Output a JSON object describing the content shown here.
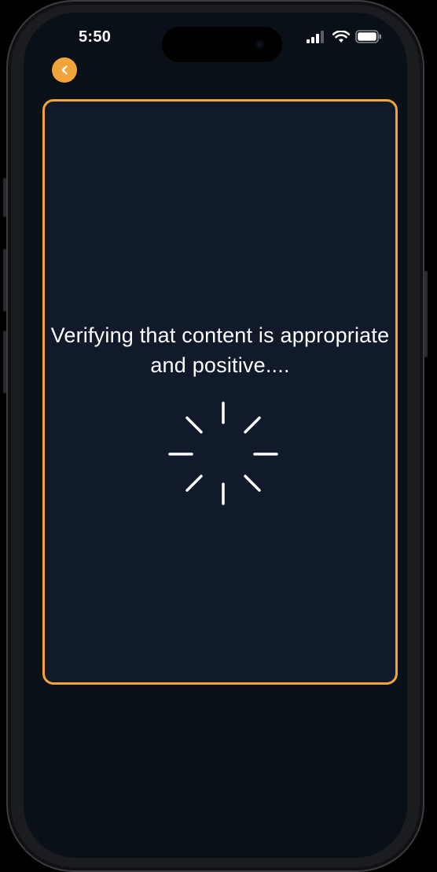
{
  "status_bar": {
    "time": "5:50",
    "icons": [
      "signal-icon",
      "wifi-icon",
      "battery-icon"
    ]
  },
  "header": {
    "back_label": "<"
  },
  "card": {
    "message": "Verifying that content is appropriate and positive....",
    "spinner_icon": "loading-spinner-icon"
  },
  "colors": {
    "accent": "#f2a33a",
    "card_background": "#111a2b",
    "screen_background": "#0a1018",
    "text": "#ffffff"
  }
}
